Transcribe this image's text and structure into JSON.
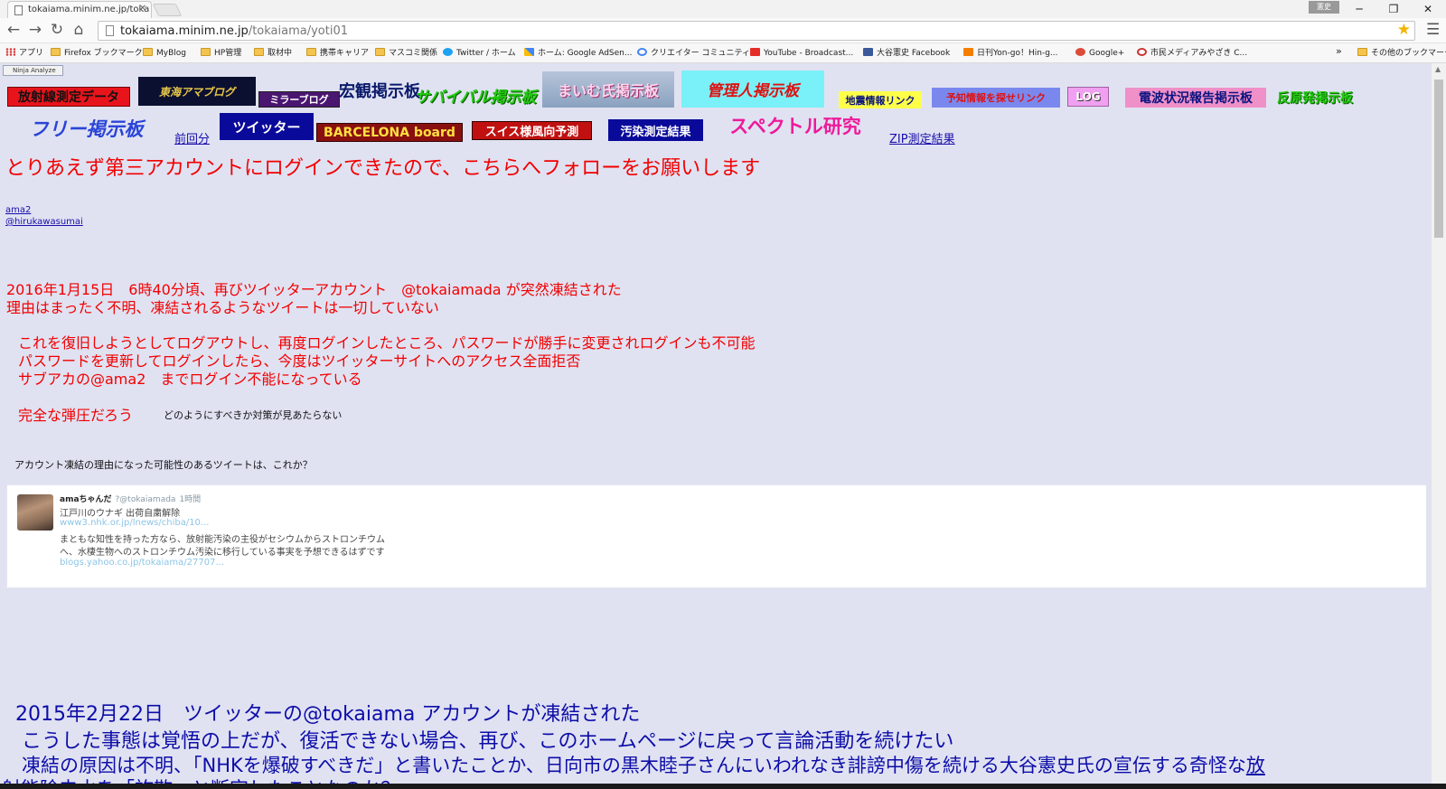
{
  "browser": {
    "tab_title": "tokaiama.minim.ne.jp/toka",
    "user_badge": "憲史",
    "url_host": "tokaiama.minim.ne.jp",
    "url_path": "/tokaiama/yoti01",
    "window_controls": [
      "─",
      "❐",
      "✕"
    ]
  },
  "bookmarks": [
    {
      "label": "アプリ",
      "icon": "apps-icon"
    },
    {
      "label": "Firefox ブックマーク",
      "icon": "folder-icon"
    },
    {
      "label": "MyBlog",
      "icon": "folder-icon"
    },
    {
      "label": "HP管理",
      "icon": "folder-icon"
    },
    {
      "label": "取材中",
      "icon": "folder-icon"
    },
    {
      "label": "携帯キャリア",
      "icon": "folder-icon"
    },
    {
      "label": "マスコミ関係",
      "icon": "folder-icon"
    },
    {
      "label": "Twitter / ホーム",
      "icon": "twitter-icon"
    },
    {
      "label": "ホーム: Google AdSen...",
      "icon": "adsense-icon"
    },
    {
      "label": "クリエイター コミュニティ...",
      "icon": "google-icon"
    },
    {
      "label": "YouTube - Broadcast...",
      "icon": "youtube-icon"
    },
    {
      "label": "大谷憲史 Facebook",
      "icon": "facebook-icon"
    },
    {
      "label": "日刊Yon-go！Hin-g...",
      "icon": "blogger-icon"
    },
    {
      "label": "Google+",
      "icon": "google-plus-icon"
    },
    {
      "label": "市民メディアみやざき C...",
      "icon": "media-icon"
    }
  ],
  "bookmarks_more": "»",
  "bookmarks_other": "その他のブックマーク",
  "ninja": "Ninja Analyze",
  "nav": {
    "radiation_data": "放射線測定データ",
    "tokai_ama_blog": "東海アマブログ",
    "mirror_blog": "ミラーブログ",
    "macro_board": "宏観掲示板",
    "survival_board": "サバイバル掲示板",
    "maiko_board": "まいむ氏掲示板",
    "admin_board": "管理人掲示板",
    "quake_links": "地震情報リンク",
    "quake_predict": "予知情報を探せリンク",
    "log": "LOG",
    "radio_board": "電波状況報告掲示板",
    "anti_nuke_board": "反原発掲示板",
    "free_board": "フリー掲示板",
    "previous": "前回分",
    "twitter": "ツイッター",
    "barcelona": "BARCELONA board",
    "swiss_wind": "スイス様風向予測",
    "contamination": "汚染測定結果",
    "spectrum": "スペクトル研究",
    "zip": "ZIP測定結果"
  },
  "content": {
    "title": "とりあえず第三アカウントにログインできたので、こちらへフォローをお願いします",
    "link1": "ama2",
    "link2": "@hirukawasumai",
    "p1_l1": "2016年1月15日　6時40分頃、再びツイッターアカウント　@tokaiamada が突然凍結された",
    "p1_l2": "理由はまったく不明、凍結されるようなツイートは一切していない",
    "p2_l1": "これを復旧しようとしてログアウトし、再度ログインしたところ、パスワードが勝手に変更されログインも不可能",
    "p2_l2": "パスワードを更新してログインしたら、今度はツイッターサイトへのアクセス全面拒否",
    "p2_l3": "サブアカの@ama2　までログイン不能になっている",
    "oppression": "完全な弾圧だろう",
    "no_remedy": "どのようにすべきか対策が見あたらない",
    "possible_cause": "アカウント凍結の理由になった可能性のあるツイートは、これか？",
    "blue_l1": "2015年2月22日　ツイッターの@tokaiama アカウントが凍結された",
    "blue_l2": "こうした事態は覚悟の上だが、復活できない場合、再び、このホームページに戻って言論活動を続けたい",
    "blue_l3_pre": "凍結の原因は不明、「NHKを爆破すべきだ」と書いたことか、日向市の黒木睦子さんにいわれなき誹謗中傷を続ける大谷憲史氏の宣伝する奇怪な",
    "blue_l3_link": "放",
    "blue_l4": "射能除去水を「詐欺」と断定したことなのか？"
  },
  "tweet": {
    "name": "amaちゃんだ",
    "handle": "?@tokaiamada",
    "time": "1時間",
    "line1": "江戸川のウナギ 出荷自粛解除",
    "link1": "www3.nhk.or.jp/lnews/chiba/10...",
    "line2": "まともな知性を持った方なら、放射能汚染の主役がセシウムからストロンチウム",
    "line3": "へ、水棲生物へのストロンチウム汚染に移行している事実を予想できるはずです",
    "link2": "blogs.yahoo.co.jp/tokaiama/27707..."
  }
}
